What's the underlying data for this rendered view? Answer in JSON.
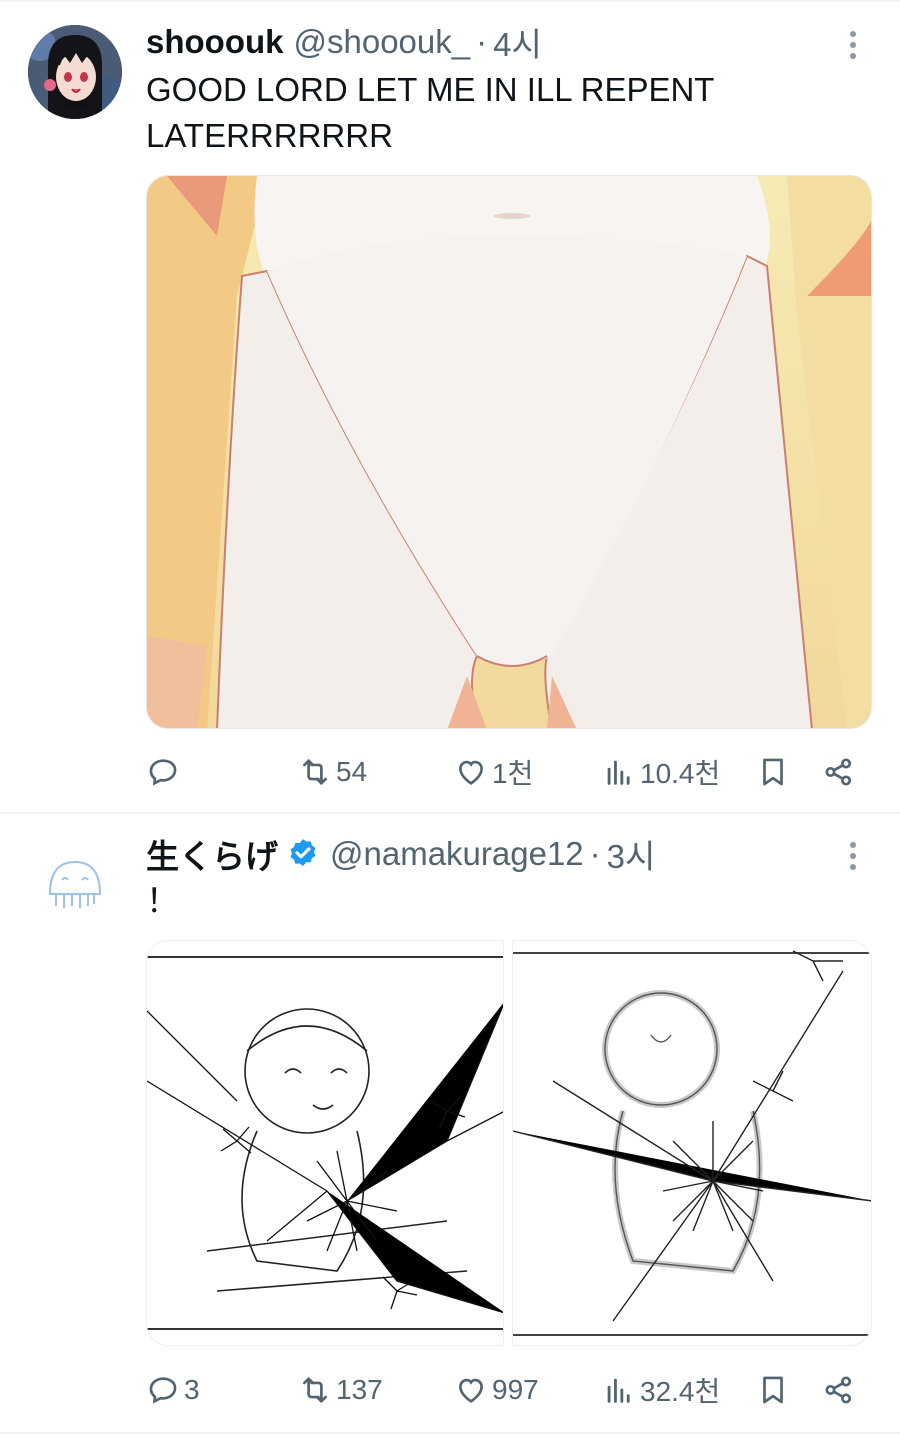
{
  "tweets": [
    {
      "author": {
        "name": "shooouk",
        "handle": "@shooouk_",
        "avatar_icon": "anime-girl-avatar"
      },
      "dot": "·",
      "time": "4시",
      "text_lines": [
        "GOOD LORD LET ME IN ILL REPENT",
        "LATERRRRRRR"
      ],
      "media": [
        {
          "type": "image",
          "description_icon": "anime-illustration-image"
        }
      ],
      "actions": {
        "reply": "",
        "retweet": "54",
        "like": "1천",
        "views": "10.4천"
      }
    },
    {
      "author": {
        "name": "生くらげ",
        "handle": "@namakurage12",
        "verified": true,
        "avatar_icon": "jellyfish-avatar"
      },
      "dot": "·",
      "time": "3시",
      "text_lines": [
        "！"
      ],
      "media": [
        {
          "type": "image",
          "description_icon": "sketch-character-sparks-image"
        },
        {
          "type": "image",
          "description_icon": "sketch-character-sparks-blur-image"
        }
      ],
      "actions": {
        "reply": "3",
        "retweet": "137",
        "like": "997",
        "views": "32.4천"
      }
    }
  ],
  "colors": {
    "text_primary": "#0f1419",
    "text_secondary": "#536471",
    "verified_blue": "#1d9bf0",
    "divider": "#eff3f4"
  }
}
